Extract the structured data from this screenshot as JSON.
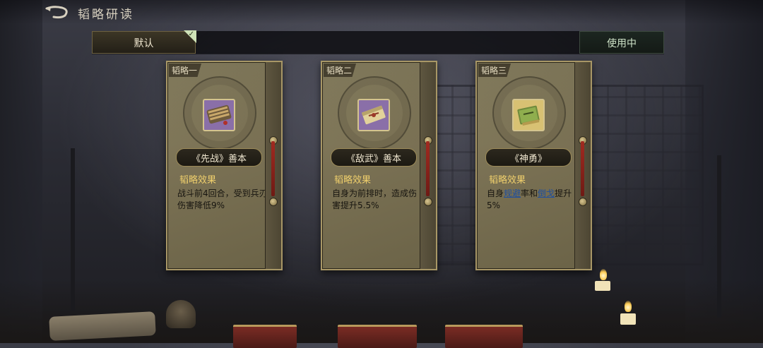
{
  "header": {
    "title": "韬略研读"
  },
  "tabs": {
    "default_label": "默认",
    "in_use_label": "使用中"
  },
  "cards": [
    {
      "tag": "韬略一",
      "name": "《先战》善本",
      "effect_title": "韬略效果",
      "effect_text": "战斗前4回合，受到兵刃伤害降低9%",
      "icon": "purple-bamboo-scroll-icon",
      "icon_bg": "#8a6fa8"
    },
    {
      "tag": "韬略二",
      "name": "《敌武》善本",
      "effect_title": "韬略效果",
      "effect_text": "自身为前排时，造成伤害提升5.5%",
      "icon": "purple-book-scroll-icon",
      "icon_bg": "#8a6fa8"
    },
    {
      "tag": "韬略三",
      "name": "《神勇》",
      "effect_title": "韬略效果",
      "effect_prefix": "自身",
      "effect_link1": "规避",
      "effect_mid": "率和",
      "effect_link2": "倒戈",
      "effect_suffix": "提升5%",
      "icon": "green-book-icon",
      "icon_bg": "#d8c173"
    }
  ],
  "colors": {
    "accent_gold": "#efcf6c",
    "keyword_blue": "#1f4f9e",
    "check_green": "#cfe3b8"
  }
}
